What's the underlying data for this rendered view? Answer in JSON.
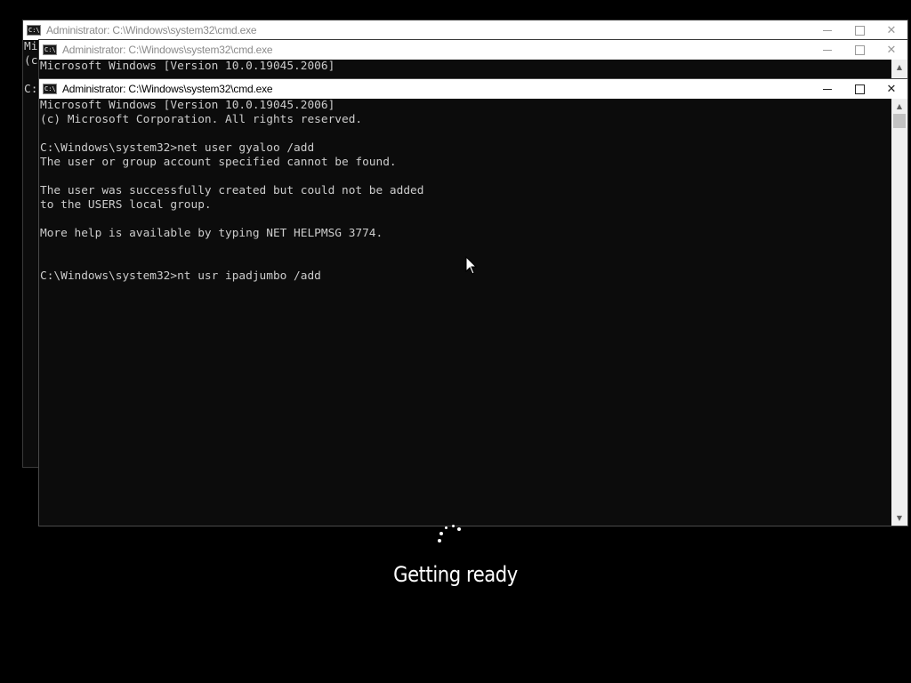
{
  "windows": {
    "back": {
      "title": "Administrator: C:\\Windows\\system32\\cmd.exe",
      "visible_text": "Mi\n(c\n\nC:"
    },
    "middle": {
      "title": "Administrator: C:\\Windows\\system32\\cmd.exe",
      "visible_text": "Microsoft Windows [Version 10.0.19045.2006]"
    },
    "front": {
      "title": "Administrator: C:\\Windows\\system32\\cmd.exe",
      "console_lines": [
        "Microsoft Windows [Version 10.0.19045.2006]",
        "(c) Microsoft Corporation. All rights reserved.",
        "",
        "C:\\Windows\\system32>net user gyaloo /add",
        "The user or group account specified cannot be found.",
        "",
        "The user was successfully created but could not be added",
        "to the USERS local group.",
        "",
        "More help is available by typing NET HELPMSG 3774.",
        "",
        "",
        "C:\\Windows\\system32>nt usr ipadjumbo /add"
      ]
    }
  },
  "controls": {
    "minimize_icon": "minimize-icon",
    "maximize_icon": "maximize-icon",
    "close_icon": "close-icon",
    "close_glyph": "✕",
    "scroll_up_glyph": "▲",
    "scroll_down_glyph": "▼"
  },
  "app_icon_text": "C:\\",
  "setup_status": {
    "message": "Getting ready"
  },
  "colors": {
    "console_bg": "#0c0c0c",
    "console_text": "#cccccc",
    "titlebar_bg": "#ffffff",
    "desktop_bg": "#000000"
  }
}
